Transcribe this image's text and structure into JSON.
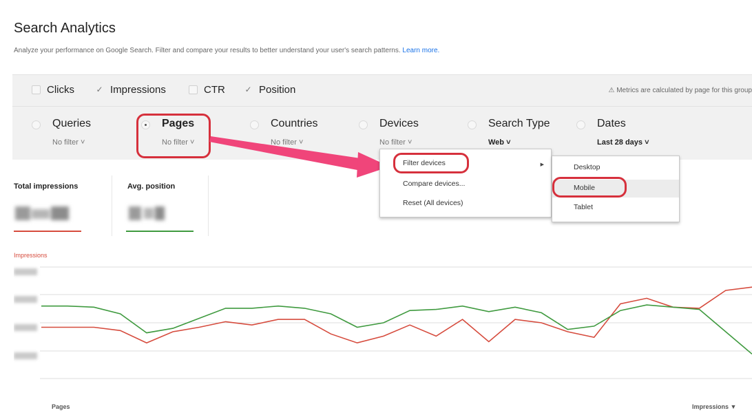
{
  "header": {
    "title": "Search Analytics",
    "subtitle": "Analyze your performance on Google Search. Filter and compare your results to better understand your user's search patterns.",
    "learn_more": "Learn more."
  },
  "metrics": [
    {
      "label": "Clicks",
      "checked": false
    },
    {
      "label": "Impressions",
      "checked": true
    },
    {
      "label": "CTR",
      "checked": false
    },
    {
      "label": "Position",
      "checked": true
    }
  ],
  "metrics_note": "⚠ Metrics are calculated by page for this group",
  "dimensions": [
    {
      "label": "Queries",
      "sub": "No filter ˅",
      "selected": false
    },
    {
      "label": "Pages",
      "sub": "No filter ˅",
      "selected": true
    },
    {
      "label": "Countries",
      "sub": "No filter ˅",
      "selected": false
    },
    {
      "label": "Devices",
      "sub": "No filter ˅",
      "selected": false
    },
    {
      "label": "Search Type",
      "sub": "Web ˅",
      "selected": false
    },
    {
      "label": "Dates",
      "sub": "Last 28 days ˅",
      "selected": false
    }
  ],
  "devices_menu": {
    "items": [
      "Filter devices",
      "Compare devices...",
      "Reset (All devices)"
    ],
    "arrow": "▶"
  },
  "device_submenu": {
    "items": [
      "Desktop",
      "Mobile",
      "Tablet"
    ]
  },
  "cards": [
    {
      "label": "Total impressions",
      "color": "#d64b3d"
    },
    {
      "label": "Avg. position",
      "color": "#3f9a3f"
    }
  ],
  "chart_data": {
    "type": "line",
    "legend": [
      "Impressions"
    ],
    "series": [
      {
        "name": "Impressions",
        "color": "#d64b3d",
        "values": [
          476,
          476,
          476,
          473,
          462,
          472,
          476,
          481,
          478,
          483,
          483,
          470,
          462,
          468,
          478,
          468,
          483,
          463,
          483,
          480,
          472,
          467,
          497,
          502,
          494,
          493,
          509,
          512
        ]
      },
      {
        "name": "",
        "color": "#3f9a3f",
        "values": [
          495,
          495,
          494,
          488,
          471,
          475,
          484,
          493,
          493,
          495,
          493,
          488,
          476,
          480,
          491,
          492,
          495,
          490,
          494,
          489,
          474,
          477,
          491,
          496,
          494,
          492,
          472,
          452
        ]
      }
    ]
  },
  "table": {
    "col_pages": "Pages",
    "col_impressions": "Impressions ▼"
  },
  "colors": {
    "highlight": "#d6303c",
    "arrow": "#f0457a",
    "link": "#1a73e8"
  }
}
